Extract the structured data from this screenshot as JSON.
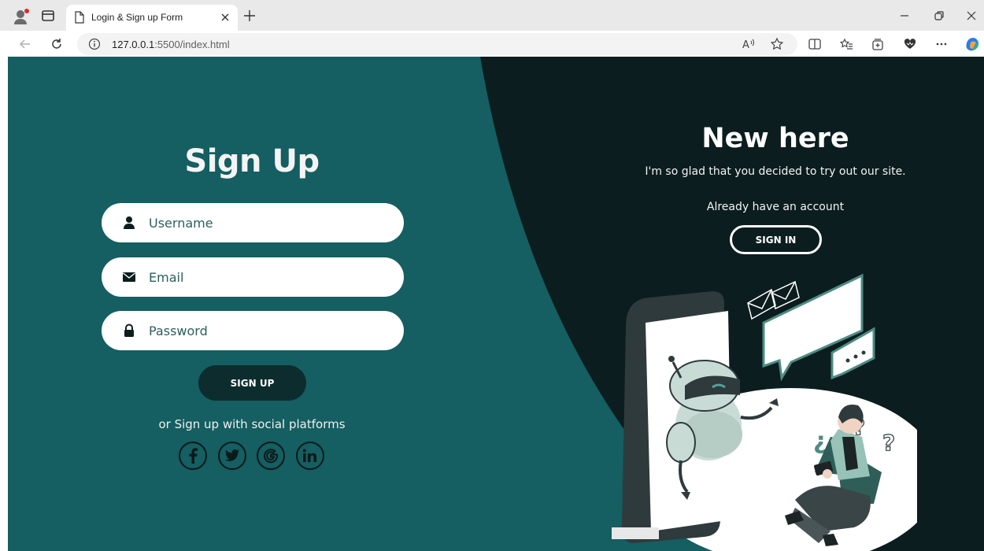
{
  "browser": {
    "tab_title": "Login & Sign up Form",
    "url_host": "127.0.0.1",
    "url_rest": ":5500/index.html"
  },
  "signup": {
    "title": "Sign Up",
    "username_placeholder": "Username",
    "email_placeholder": "Email",
    "password_placeholder": "Password",
    "button_label": "SIGN UP",
    "social_text": "or Sign up with social platforms",
    "social": [
      {
        "icon": "facebook-icon",
        "glyph": "f"
      },
      {
        "icon": "twitter-icon",
        "glyph": "🐦"
      },
      {
        "icon": "google-icon",
        "glyph": "G"
      },
      {
        "icon": "linkedin-icon",
        "glyph": "in"
      }
    ]
  },
  "panel": {
    "title": "New here",
    "subtitle": "I'm so glad that you decided to try out our site.",
    "prompt": "Already have an account",
    "button_label": "SIGN IN"
  },
  "colors": {
    "teal": "#155e61",
    "dark": "#0b1d1e",
    "button_dark": "#0d2c2e"
  }
}
